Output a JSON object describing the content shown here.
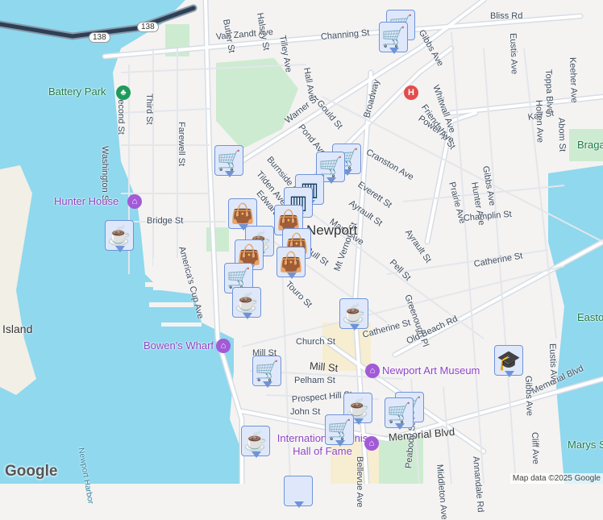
{
  "colors": {
    "water": "#8fd8ee",
    "land": "#f4f3f2",
    "park": "#cdebd0",
    "road": "#ffffff",
    "road_edge": "#d7dde4",
    "marker_bg": "#dfe8fb",
    "marker_border": "#6f93d8",
    "hospital": "#e24c4c",
    "museum": "#a25ad6",
    "park_pin": "#1e9b5a"
  },
  "city": "Newport",
  "streets": [
    "Bliss Rd",
    "Van Zandt Ave",
    "Channing St",
    "Gibbs Ave",
    "Butler St",
    "Halsey St",
    "Tilley Ave",
    "Hall Ave",
    "Whitwall Ave",
    "Eustis Ave",
    "Toppa Blvd",
    "Keeher Ave",
    "Third St",
    "Second St",
    "Washington St",
    "Farewell St",
    "Warner St",
    "Gould St",
    "Broadway",
    "Friendship St",
    "Powel Ave",
    "Kay St",
    "Holten Ave",
    "Abom St",
    "Pond Ave",
    "Cranston Ave",
    "Burnside Ave",
    "Tilden Ave",
    "Edward St",
    "Everett St",
    "Ayrault St",
    "Gibbs Ave",
    "Hunter Ave",
    "Prairie Ave",
    "Bridge St",
    "Mann Ave",
    "Champlin St",
    "Bull St",
    "Pell St",
    "Catherine St",
    "America's Cup Ave",
    "Touro St",
    "Mt Vernon St",
    "Greenough Pl",
    "Old Beach Rd",
    "Church St",
    "Catherine St",
    "Mill St",
    "Mill St",
    "Pelham St",
    "Prospect Hill St",
    "John St",
    "Memorial Blvd",
    "Memorial Blvd",
    "Bellevue Ave",
    "Peabody St",
    "Middleton Ave",
    "Annandale Rd",
    "Cliff Ave",
    "Eustis Ave",
    "Gibbs Ave",
    "Ayrault St",
    "Newport Harbor",
    "Island"
  ],
  "route_shields": [
    "138",
    "138"
  ],
  "pois": {
    "battery_park": "Battery Park",
    "hunter_house": "Hunter House",
    "bowens_wharf": "Bowen's Wharf",
    "hospital": "H",
    "art_museum": "Newport Art Museum",
    "tennis_hof": "International Tennis Hall of Fame",
    "braga_park": "Braga Park",
    "easton": "Easton",
    "marys": "Marys S"
  },
  "attribution": "Map data ©2025 Google",
  "logo": "Google"
}
